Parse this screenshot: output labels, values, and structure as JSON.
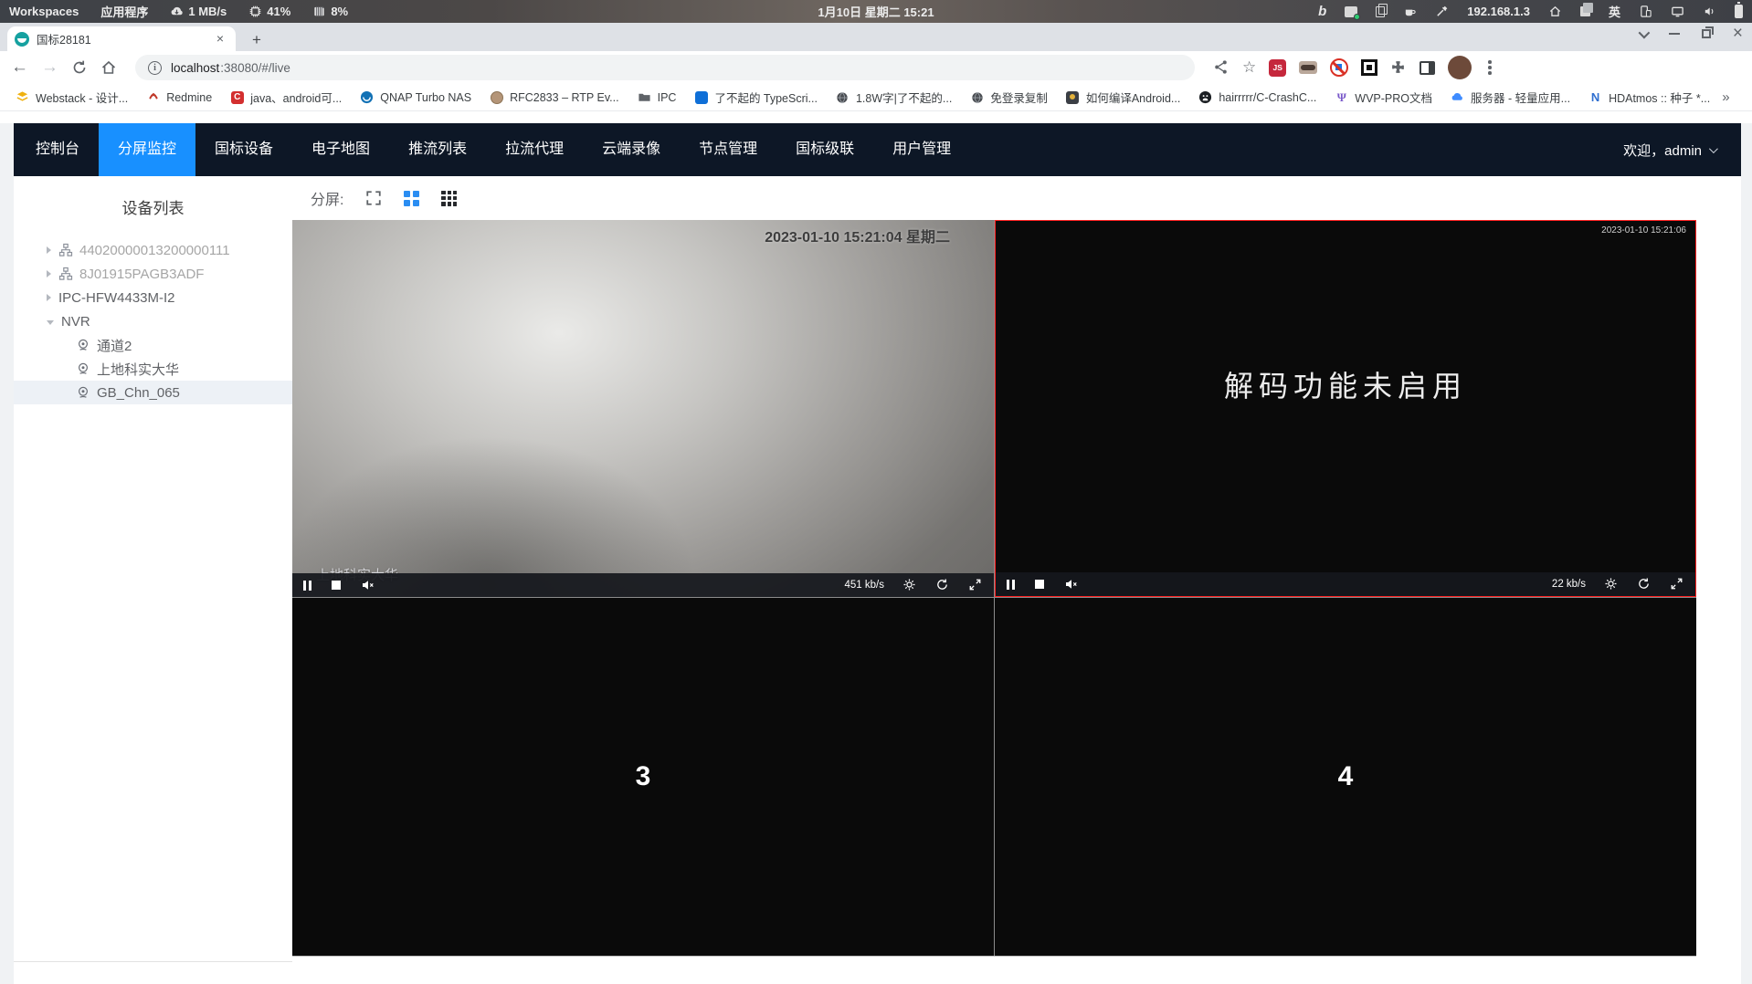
{
  "system_bar": {
    "workspaces": "Workspaces",
    "applications": "应用程序",
    "net_speed": "1 MB/s",
    "cpu": "41%",
    "memory": "8%",
    "clock": "1月10日 星期二 15:21",
    "ip": "192.168.1.3",
    "input_lang": "英"
  },
  "browser": {
    "tab_title": "国标28181",
    "url_host": "localhost",
    "url_rest": ":38080/#/live",
    "js_badge": "JS",
    "bookmarks": [
      "Webstack - 设计...",
      "Redmine",
      "java、android可...",
      "QNAP Turbo NAS",
      "RFC2833 – RTP Ev...",
      "IPC",
      "了不起的 TypeScri...",
      "1.8W字|了不起的...",
      "免登录复制",
      "如何编译Android...",
      "hairrrrr/C-CrashC...",
      "WVP-PRO文档",
      "服务器 - 轻量应用...",
      "HDAtmos :: 种子 *..."
    ],
    "bookmarks_overflow": "»"
  },
  "app": {
    "nav": {
      "items": [
        "控制台",
        "分屏监控",
        "国标设备",
        "电子地图",
        "推流列表",
        "拉流代理",
        "云端录像",
        "节点管理",
        "国标级联",
        "用户管理"
      ],
      "active": "分屏监控",
      "welcome": "欢迎，admin"
    },
    "sidebar": {
      "title": "设备列表",
      "tree": [
        {
          "label": "44020000013200000111"
        },
        {
          "label": "8J01915PAGB3ADF"
        },
        {
          "label": "IPC-HFW4433M-I2"
        },
        {
          "label": "NVR"
        },
        {
          "label": "通道2"
        },
        {
          "label": "上地科实大华"
        },
        {
          "label": "GB_Chn_065",
          "selected": true
        }
      ]
    },
    "split_label": "分屏:",
    "players": {
      "p1": {
        "osd": "2023-01-10 15:21:04 星期二",
        "watermark": "上地科实大华",
        "bitrate": "451 kb/s"
      },
      "p2": {
        "osd": "2023-01-10 15:21:06",
        "message": "解码功能未启用",
        "bitrate": "22 kb/s"
      },
      "p3": {
        "number": "3"
      },
      "p4": {
        "number": "4"
      }
    }
  },
  "colors": {
    "accent": "#1890ff",
    "navbar_bg": "#0d1726",
    "selected_cell_border": "#ff2020"
  }
}
